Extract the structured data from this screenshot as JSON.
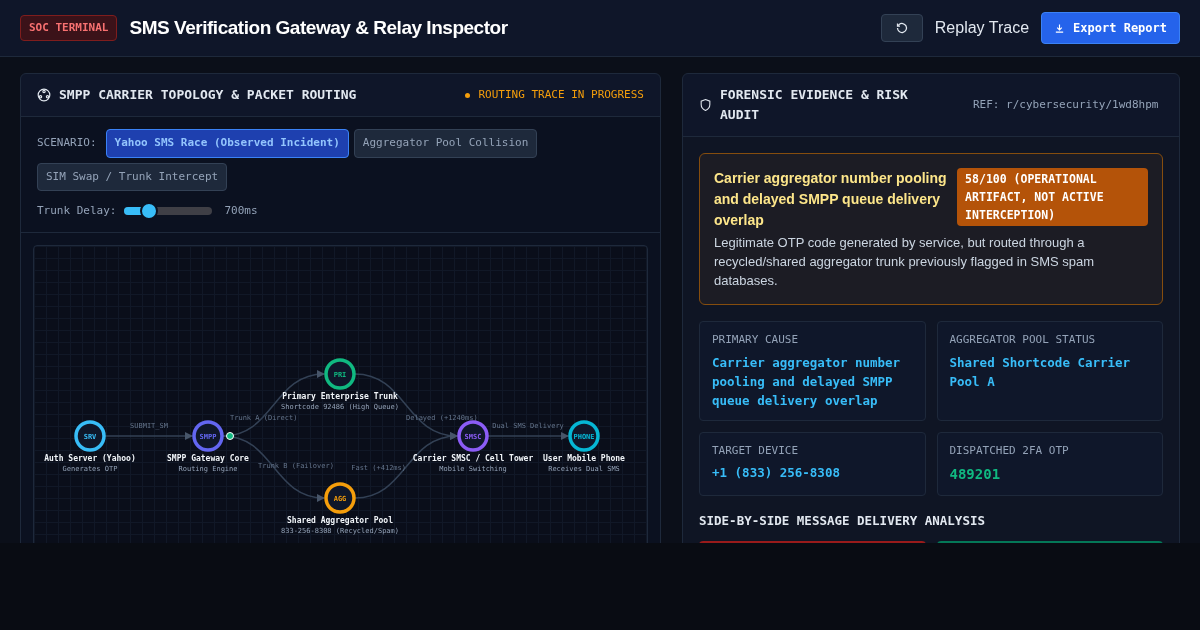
{
  "header": {
    "badge": "SOC TERMINAL",
    "title": "SMS Verification Gateway & Relay Inspector",
    "replay_button": "Replay Trace",
    "export_button": "Export Report"
  },
  "topology": {
    "title": "SMPP CARRIER TOPOLOGY & PACKET ROUTING",
    "status": "ROUTING TRACE IN PROGRESS",
    "scenario_label": "SCENARIO:",
    "scenarios": [
      {
        "label": "Yahoo SMS Race (Observed Incident)",
        "selected": true
      },
      {
        "label": "Aggregator Pool Collision",
        "selected": false
      },
      {
        "label": "SIM Swap / Trunk Intercept",
        "selected": false
      }
    ],
    "delay": {
      "label": "Trunk Delay:",
      "level": 0.28,
      "reading": "700ms"
    },
    "nodes": [
      {
        "code": "SRV",
        "name": "Auth Server (Yahoo)",
        "sub": "Generates OTP",
        "color": "#38bdf8"
      },
      {
        "code": "SMPP",
        "name": "SMPP Gateway Core",
        "sub": "Routing Engine",
        "color": "#6366f1"
      },
      {
        "code": "PRI",
        "name": "Primary Enterprise Trunk",
        "sub": "Shortcode 92486 (High Queue)",
        "color": "#10b981"
      },
      {
        "code": "AGG",
        "name": "Shared Aggregator Pool",
        "sub": "833-256-8308 (Recycled/Spam)",
        "color": "#f59e0b"
      },
      {
        "code": "SMSC",
        "name": "Carrier SMSC / Cell Tower",
        "sub": "Mobile Switching",
        "color": "#8b5cf6"
      },
      {
        "code": "PHONE",
        "name": "User Mobile Phone",
        "sub": "Receives Dual SMS",
        "color": "#06b6d4"
      }
    ],
    "edges": [
      {
        "label": "SUBMIT_SM"
      },
      {
        "label": "Trunk A (Direct)"
      },
      {
        "label": "Trunk B (Failover)"
      },
      {
        "label": "Delayed (+1240ms)"
      },
      {
        "label": "Fast (+412ms)"
      },
      {
        "label": "Dual SMS Delivery"
      }
    ]
  },
  "audit": {
    "title": "FORENSIC EVIDENCE & RISK AUDIT",
    "ref": "REF: r/cybersecurity/1wd8hpm",
    "verdict": {
      "title": "Carrier aggregator number pooling and delayed SMPP queue delivery overlap",
      "score": "58/100 (OPERATIONAL ARTIFACT, NOT ACTIVE INTERCEPTION)",
      "text": "Legitimate OTP code generated by service, but routed through a recycled/shared aggregator trunk previously flagged in SMS spam databases."
    },
    "facts": [
      {
        "label": "PRIMARY CAUSE",
        "value": "Carrier aggregator number pooling and delayed SMPP queue delivery overlap",
        "kind": "info"
      },
      {
        "label": "AGGREGATOR POOL STATUS",
        "value": "Shared Shortcode Carrier Pool A",
        "kind": "info"
      },
      {
        "label": "TARGET DEVICE",
        "value": "+1 (833) 256-8308",
        "kind": "info"
      },
      {
        "label": "DISPATCHED 2FA OTP",
        "value": "489201",
        "kind": "code"
      }
    ],
    "analysis_title": "SIDE-BY-SIDE MESSAGE DELIVERY ANALYSIS"
  }
}
